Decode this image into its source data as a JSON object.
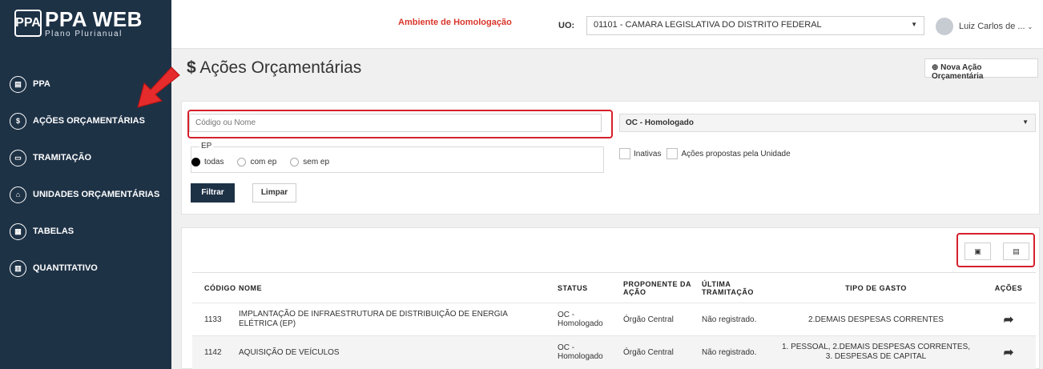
{
  "logo": {
    "mark": "PPA",
    "title": "PPA WEB",
    "subtitle": "Plano Plurianual"
  },
  "sidebar": {
    "items": [
      {
        "label": "PPA",
        "icon": "document-icon",
        "glyph": "▤"
      },
      {
        "label": "AÇÕES ORÇAMENTÁRIAS",
        "icon": "dollar-icon",
        "glyph": "$"
      },
      {
        "label": "TRAMITAÇÃO",
        "icon": "inbox-icon",
        "glyph": "▭"
      },
      {
        "label": "UNIDADES ORÇAMENTÁRIAS",
        "icon": "building-icon",
        "glyph": "⌂"
      },
      {
        "label": "TABELAS",
        "icon": "table-icon",
        "glyph": "▦"
      },
      {
        "label": "QUANTITATIVO",
        "icon": "bar-chart-icon",
        "glyph": "▥"
      }
    ]
  },
  "topbar": {
    "environment": "Ambiente de Homologação",
    "uo_label": "UO:",
    "uo_value": "01101 - CAMARA LEGISLATIVA DO DISTRITO FEDERAL",
    "user": "Luiz Carlos de ..."
  },
  "page": {
    "title": "Ações Orçamentárias",
    "title_icon": "$",
    "new_button": "Nova Ação Orçamentária"
  },
  "filters": {
    "search_placeholder": "Código ou Nome",
    "status_value": "OC - Homologado",
    "ep_label": "EP",
    "ep_options": [
      "todas",
      "com ep",
      "sem ep"
    ],
    "ep_selected": "todas",
    "check_inactive": "Inativas",
    "check_proposed": "Ações propostas pela Unidade",
    "filter_button": "Filtrar",
    "clear_button": "Limpar"
  },
  "exports": {
    "pdf_icon": "pdf-file-icon",
    "excel_icon": "excel-file-icon"
  },
  "table": {
    "headers": [
      "CÓDIGO",
      "NOME",
      "STATUS",
      "PROPONENTE DA AÇÃO",
      "ÚLTIMA TRAMITAÇÃO",
      "TIPO DE GASTO",
      "AÇÕES"
    ],
    "rows": [
      {
        "code": "1133",
        "name": "IMPLANTAÇÃO DE INFRAESTRUTURA DE DISTRIBUIÇÃO DE ENERGIA ELÉTRICA (EP)",
        "status": "OC - Homologado",
        "proponent": "Órgão Central",
        "last": "Não registrado.",
        "type": "2.DEMAIS DESPESAS CORRENTES"
      },
      {
        "code": "1142",
        "name": "AQUISIÇÃO DE VEÍCULOS",
        "status": "OC - Homologado",
        "proponent": "Órgão Central",
        "last": "Não registrado.",
        "type": "1. PESSOAL, 2.DEMAIS DESPESAS CORRENTES, 3. DESPESAS DE CAPITAL"
      }
    ]
  },
  "colors": {
    "sidebar": "#1e3246",
    "highlight": "#d5202b",
    "environment": "#d9362b"
  }
}
